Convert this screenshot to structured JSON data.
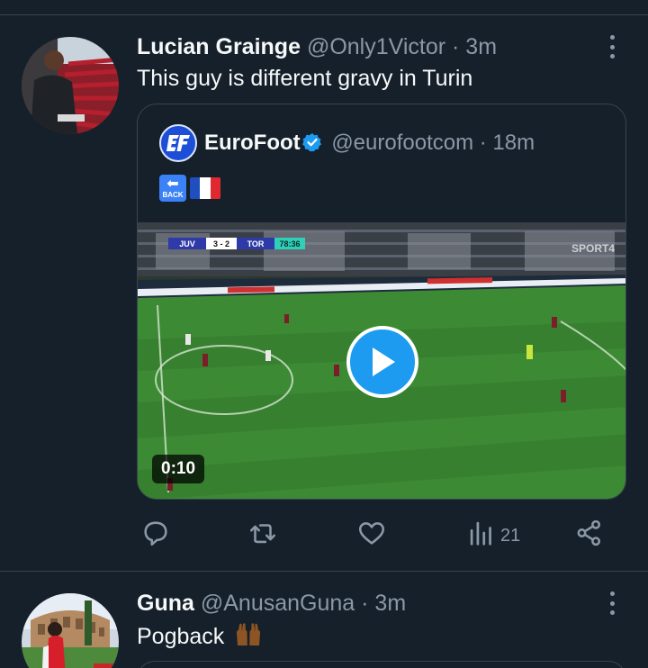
{
  "tweet1": {
    "author_name": "Lucian Grainge",
    "handle": "@Only1Victor",
    "time": "· 3m",
    "text": "This guy is different gravy in Turin",
    "avatar_icon": "stadium-photo-avatar",
    "quote": {
      "author_name": "EuroFoot",
      "handle": "@eurofootcom",
      "time": "· 18m",
      "verified": true,
      "emojis": [
        "back-arrow-emoji",
        "france-flag-emoji"
      ],
      "back_emoji_text": "BACK",
      "video": {
        "duration": "0:10",
        "scorebug": {
          "home": "JUV",
          "score": "3 - 2",
          "away": "TOR",
          "clock": "78:36"
        },
        "channel": "SPORT4",
        "play_icon": "play-icon"
      }
    },
    "actions": {
      "reply_icon": "reply-icon",
      "retweet_icon": "retweet-icon",
      "like_icon": "heart-icon",
      "views_icon": "views-icon",
      "views_count": "21",
      "share_icon": "share-icon"
    }
  },
  "tweet2": {
    "author_name": "Guna",
    "handle": "@AnusanGuna",
    "time": "· 3m",
    "text": "Pogback",
    "emoji": "raised-hands-emoji",
    "avatar_icon": "colosseum-photo-avatar"
  },
  "colors": {
    "background": "#15202b",
    "border": "#38444d",
    "secondary_text": "#8b98a5",
    "accent": "#1d9bf0"
  }
}
